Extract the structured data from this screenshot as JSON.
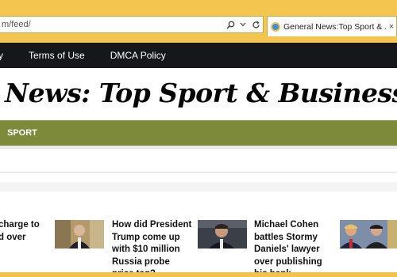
{
  "browser": {
    "address_text": "m/feed/",
    "search_icon": "search-icon",
    "dropdown_icon": "chevron-down-icon",
    "refresh_icon": "refresh-icon",
    "tab_title": "General News:Top Sport & ...",
    "tab_close": "×",
    "chrome_color": "#f2c24e"
  },
  "topnav": {
    "items": [
      "y",
      "Terms of Use",
      "DMCA Policy"
    ]
  },
  "site": {
    "title": "News: Top Sport & Business Ne"
  },
  "category_bar": {
    "label": "SPORT",
    "color": "#7d8a3a"
  },
  "articles": [
    {
      "title": "charge to\nd over",
      "thumb": "none"
    },
    {
      "title": "How did President\nTrump come up\nwith $10 million\nRussia probe\nprice tag?",
      "thumb": "man-in-suit-photo"
    },
    {
      "title": "Michael Cohen\nbattles Stormy\nDaniels' lawyer\nover publishing\nhis bank",
      "thumb": "man-portrait-photo"
    },
    {
      "title": "",
      "thumb": "two-leaders-photo"
    }
  ]
}
